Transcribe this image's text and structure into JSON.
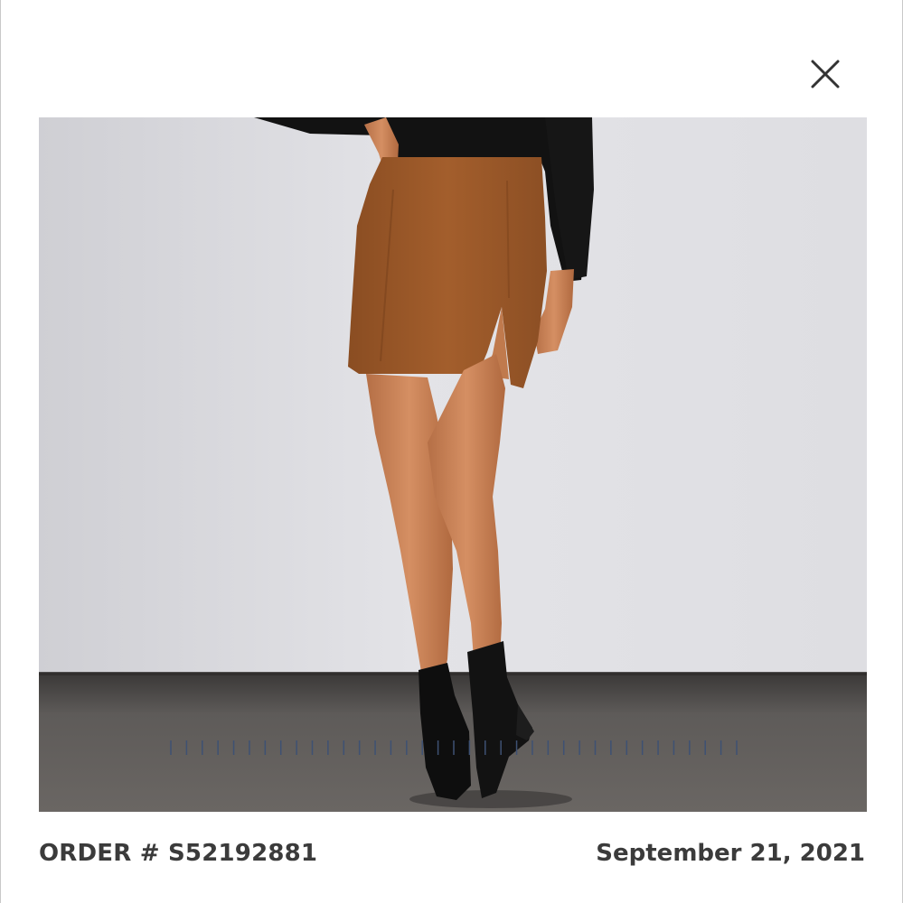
{
  "modal": {
    "close_icon": "close-icon",
    "photo_subject": "product-photo",
    "order_label": "ORDER # S52192881",
    "order_date": "September 21, 2021",
    "text_color": "#3b3b3b"
  },
  "carousel": {
    "indicator_count": 37,
    "indicator_color": "#3e5173"
  }
}
